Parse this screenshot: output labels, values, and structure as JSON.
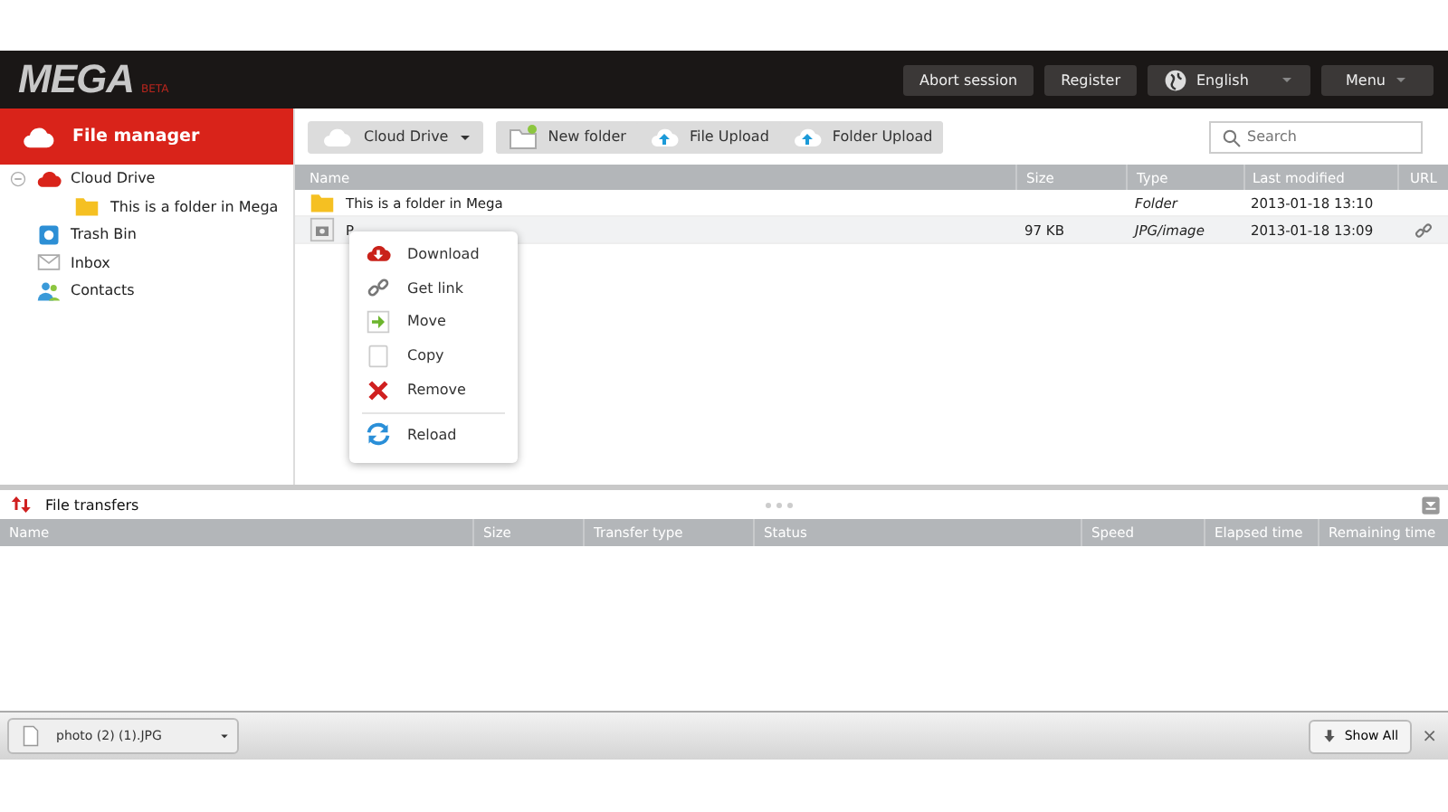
{
  "header": {
    "logo": "MEGA",
    "badge": "BETA",
    "buttons": [
      "Abort session",
      "Register"
    ],
    "language": "English",
    "menu": "Menu"
  },
  "sidebar": {
    "title": "File manager",
    "tree": [
      {
        "label": "Cloud Drive",
        "expanded": true,
        "children": [
          {
            "label": "This is a folder in Mega"
          }
        ]
      },
      {
        "label": "Trash Bin"
      },
      {
        "label": "Inbox"
      },
      {
        "label": "Contacts"
      }
    ]
  },
  "toolbar": {
    "location": "Cloud Drive",
    "actions": [
      "New folder",
      "File Upload",
      "Folder Upload"
    ],
    "search": {
      "placeholder": "Search"
    }
  },
  "files": {
    "columns": [
      "Name",
      "Size",
      "Type",
      "Last modified",
      "URL"
    ],
    "rows": [
      {
        "kind": "folder",
        "name": "This is a folder in Mega",
        "size": "",
        "type": "Folder",
        "modified": "2013-01-18 13:10",
        "linked": false,
        "selected": false
      },
      {
        "kind": "file",
        "name": "P",
        "size": "97 KB",
        "type": "JPG/image",
        "modified": "2013-01-18 13:09",
        "linked": true,
        "selected": true
      }
    ]
  },
  "context_menu": [
    {
      "label": "Download",
      "separated": false
    },
    {
      "label": "Get link",
      "separated": false
    },
    {
      "label": "Move",
      "separated": false
    },
    {
      "label": "Copy",
      "separated": false
    },
    {
      "label": "Remove",
      "separated": false
    },
    {
      "label": "Reload",
      "separated": true
    }
  ],
  "transfers": {
    "title": "File transfers",
    "columns": [
      "Name",
      "Size",
      "Transfer type",
      "Status",
      "Speed",
      "Elapsed time",
      "Remaining time"
    ]
  },
  "download_bar": {
    "file": "photo (2) (1).JPG",
    "show_all": "Show All",
    "close": "×"
  }
}
